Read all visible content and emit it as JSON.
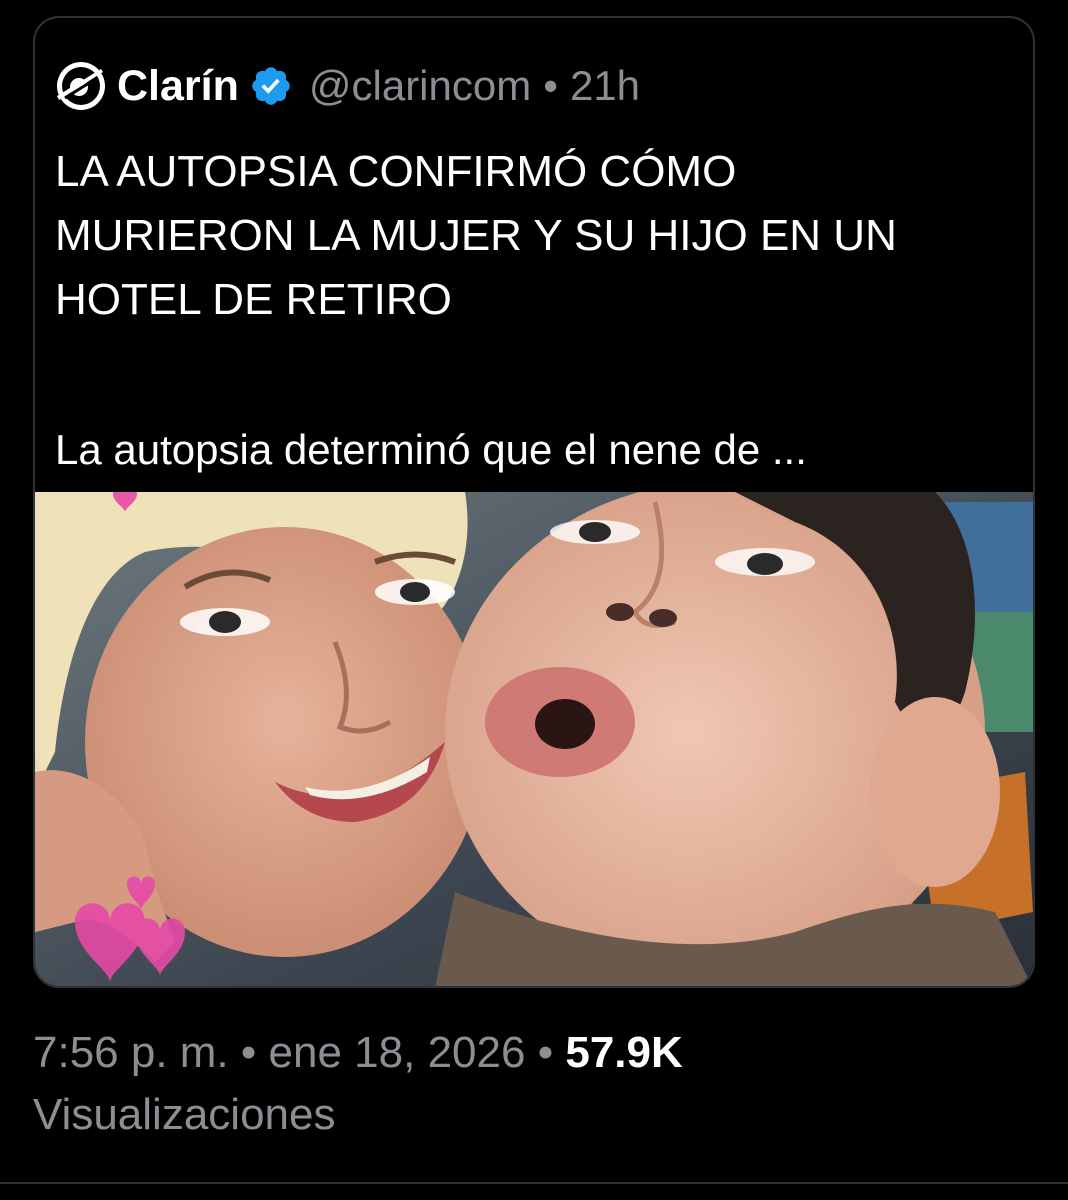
{
  "tweet": {
    "author_name": "Clarín",
    "handle": "@clarincom",
    "separator": "•",
    "relative_time": "21h",
    "headline_lines": [
      "LA AUTOPSIA CONFIRMÓ CÓMO",
      "MURIERON LA MUJER Y SU HIJO EN UN",
      "HOTEL DE RETIRO"
    ],
    "summary": "La autopsia determinó que el nene de ...",
    "icons": {
      "logo": "clarin-logo-icon",
      "verified": "verified-badge-icon"
    },
    "colors": {
      "background": "#000000",
      "text": "#ffffff",
      "muted": "#8b8f94",
      "verified": "#1d9bf0",
      "border": "#2f3336"
    }
  },
  "meta": {
    "time": "7:56 p. m.",
    "separator": "•",
    "date": "ene 18, 2026",
    "views_count": "57.9K",
    "views_label": "Visualizaciones"
  }
}
